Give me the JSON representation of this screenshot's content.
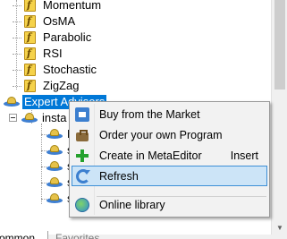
{
  "navigator": {
    "indicators": [
      "Momentum",
      "OsMA",
      "Parabolic",
      "RSI",
      "Stochastic",
      "ZigZag"
    ],
    "expert_advisors_label": "Expert Advisors",
    "insta_label": "insta",
    "sub_labels": [
      "D",
      "s",
      "s",
      "s",
      "s"
    ]
  },
  "context_menu": {
    "items": [
      {
        "label": "Buy from the Market",
        "icon": "market-icon",
        "shortcut": ""
      },
      {
        "label": "Order your own Program",
        "icon": "briefcase-icon",
        "shortcut": ""
      },
      {
        "label": "Create in MetaEditor",
        "icon": "plus-icon",
        "shortcut": "Insert"
      },
      {
        "label": "Refresh",
        "icon": "refresh-icon",
        "shortcut": ""
      },
      {
        "label": "Online library",
        "icon": "globe-icon",
        "shortcut": ""
      }
    ],
    "hovered": "Refresh"
  },
  "tabs": {
    "common": "ommon",
    "favorites": "Favorites"
  },
  "colors": {
    "selection": "#0078d7",
    "menu_hover": "#cce4f7",
    "menu_hover_border": "#3d8fd6"
  }
}
